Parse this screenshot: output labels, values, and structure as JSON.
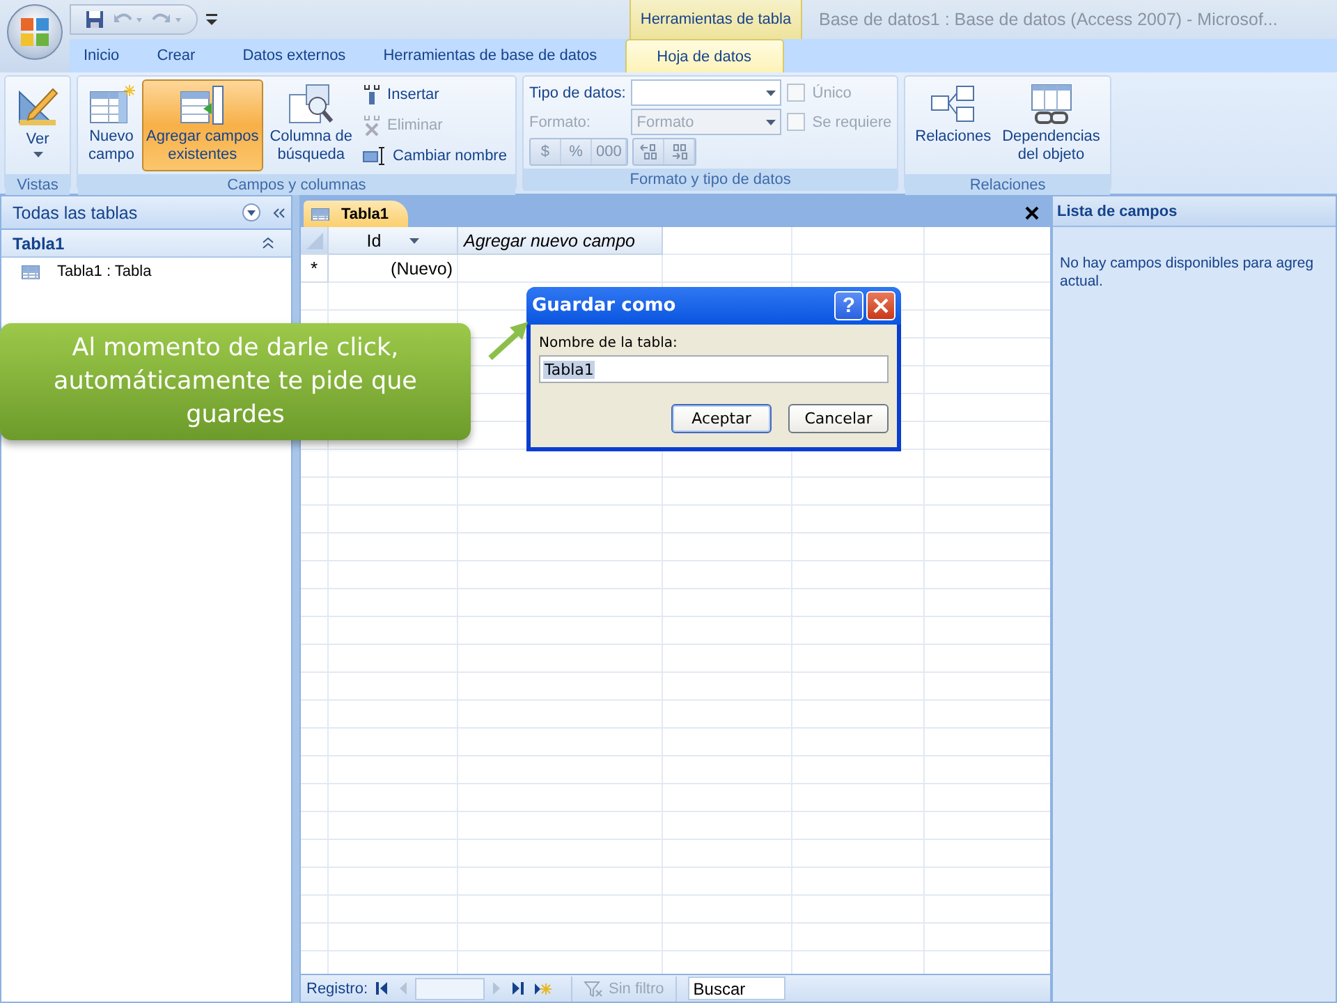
{
  "window": {
    "title": "Base de datos1 : Base de datos (Access 2007) - Microsof...",
    "contextual_group": "Herramientas de tabla"
  },
  "ribbon_tabs": [
    {
      "label": "Inicio",
      "selected": false
    },
    {
      "label": "Crear",
      "selected": false
    },
    {
      "label": "Datos externos",
      "selected": false
    },
    {
      "label": "Herramientas de base de datos",
      "selected": false
    },
    {
      "label": "Hoja de datos",
      "selected": true
    }
  ],
  "ribbon": {
    "groups": [
      {
        "title": "Vistas",
        "controls": [
          {
            "kind": "large",
            "lines": [
              "Ver"
            ],
            "dropdown": true,
            "selected": false,
            "disabled": false
          }
        ]
      },
      {
        "title": "Campos y columnas",
        "controls": [
          {
            "kind": "large",
            "lines": [
              "Nuevo",
              "campo"
            ],
            "dropdown": false,
            "selected": false,
            "disabled": false
          },
          {
            "kind": "large",
            "lines": [
              "Agregar campos",
              "existentes"
            ],
            "dropdown": false,
            "selected": true,
            "disabled": false
          },
          {
            "kind": "large",
            "lines": [
              "Columna de",
              "búsqueda"
            ],
            "dropdown": false,
            "selected": false,
            "disabled": false
          },
          {
            "kind": "stack",
            "items": [
              {
                "label": "Insertar",
                "disabled": false
              },
              {
                "label": "Eliminar",
                "disabled": true
              },
              {
                "label": "Cambiar nombre",
                "disabled": false
              }
            ]
          }
        ]
      },
      {
        "title": "Formato y tipo de datos",
        "controls": [
          {
            "kind": "format",
            "fields": [
              {
                "label": "Tipo de datos:",
                "disabled": false
              },
              {
                "label": "Formato:",
                "placeholder": "Formato",
                "disabled": true
              }
            ],
            "checkboxes": [
              {
                "label": "Único",
                "checked": false
              },
              {
                "label": "Se requiere",
                "checked": false
              }
            ],
            "buttons": [
              {
                "label": "$"
              },
              {
                "label": "%"
              },
              {
                "label": "000"
              }
            ]
          }
        ]
      },
      {
        "title": "Relaciones",
        "controls": [
          {
            "kind": "large",
            "lines": [
              "Relaciones"
            ],
            "dropdown": false,
            "selected": false,
            "disabled": false
          },
          {
            "kind": "large",
            "lines": [
              "Dependencias",
              "del objeto"
            ],
            "dropdown": false,
            "selected": false,
            "disabled": false
          }
        ]
      }
    ]
  },
  "navigation": {
    "header": "Todas las tablas",
    "groups": [
      {
        "title": "Tabla1",
        "expanded": true,
        "items": [
          "Tabla1 : Tabla"
        ]
      }
    ]
  },
  "document_tabs": [
    {
      "label": "Tabla1",
      "selected": true
    }
  ],
  "table": {
    "columns": [
      {
        "label": "Id",
        "dropdown": true,
        "italic": false
      },
      {
        "label": "Agregar nuevo campo",
        "dropdown": false,
        "italic": true
      }
    ],
    "rows": [
      {
        "marker": "*",
        "cells": [
          "(Nuevo)",
          ""
        ]
      }
    ]
  },
  "record_nav": {
    "label": "Registro:",
    "filter": "Sin filtro",
    "search_placeholder": "Buscar"
  },
  "field_list": {
    "title": "Lista de campos",
    "message_lines": [
      "No hay campos disponibles para agreg",
      "actual."
    ]
  },
  "dialog": {
    "title": "Guardar como",
    "help": "?",
    "field_label": "Nombre de la tabla:",
    "field_value": "Tabla1",
    "text_selected": true,
    "buttons": [
      {
        "label": "Aceptar",
        "default": true
      },
      {
        "label": "Cancelar",
        "default": false
      }
    ]
  },
  "callout": {
    "text": "Al momento de darle click, automáticamente te pide que guardes"
  }
}
